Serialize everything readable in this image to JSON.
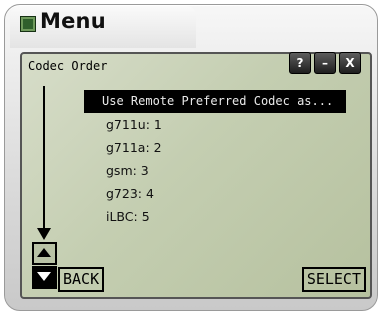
{
  "window": {
    "title": "Menu",
    "controls": {
      "help": "?",
      "minimize": "–",
      "close": "X"
    }
  },
  "screen": {
    "header": "Codec Order",
    "menu_items": [
      "Use Remote Preferred Codec as...",
      "g711u: 1",
      "g711a: 2",
      "gsm: 3",
      "g723: 4",
      "iLBC: 5"
    ],
    "selected_index": 0,
    "softkeys": {
      "back": "BACK",
      "select": "SELECT"
    }
  },
  "icons": [
    "app-icon",
    "down-arrow-icon",
    "scroll-up-icon",
    "scroll-down-icon"
  ],
  "colors": {
    "lcd": "#c4ceb1",
    "highlight": "#000000",
    "chrome": "#1e1e1e"
  }
}
